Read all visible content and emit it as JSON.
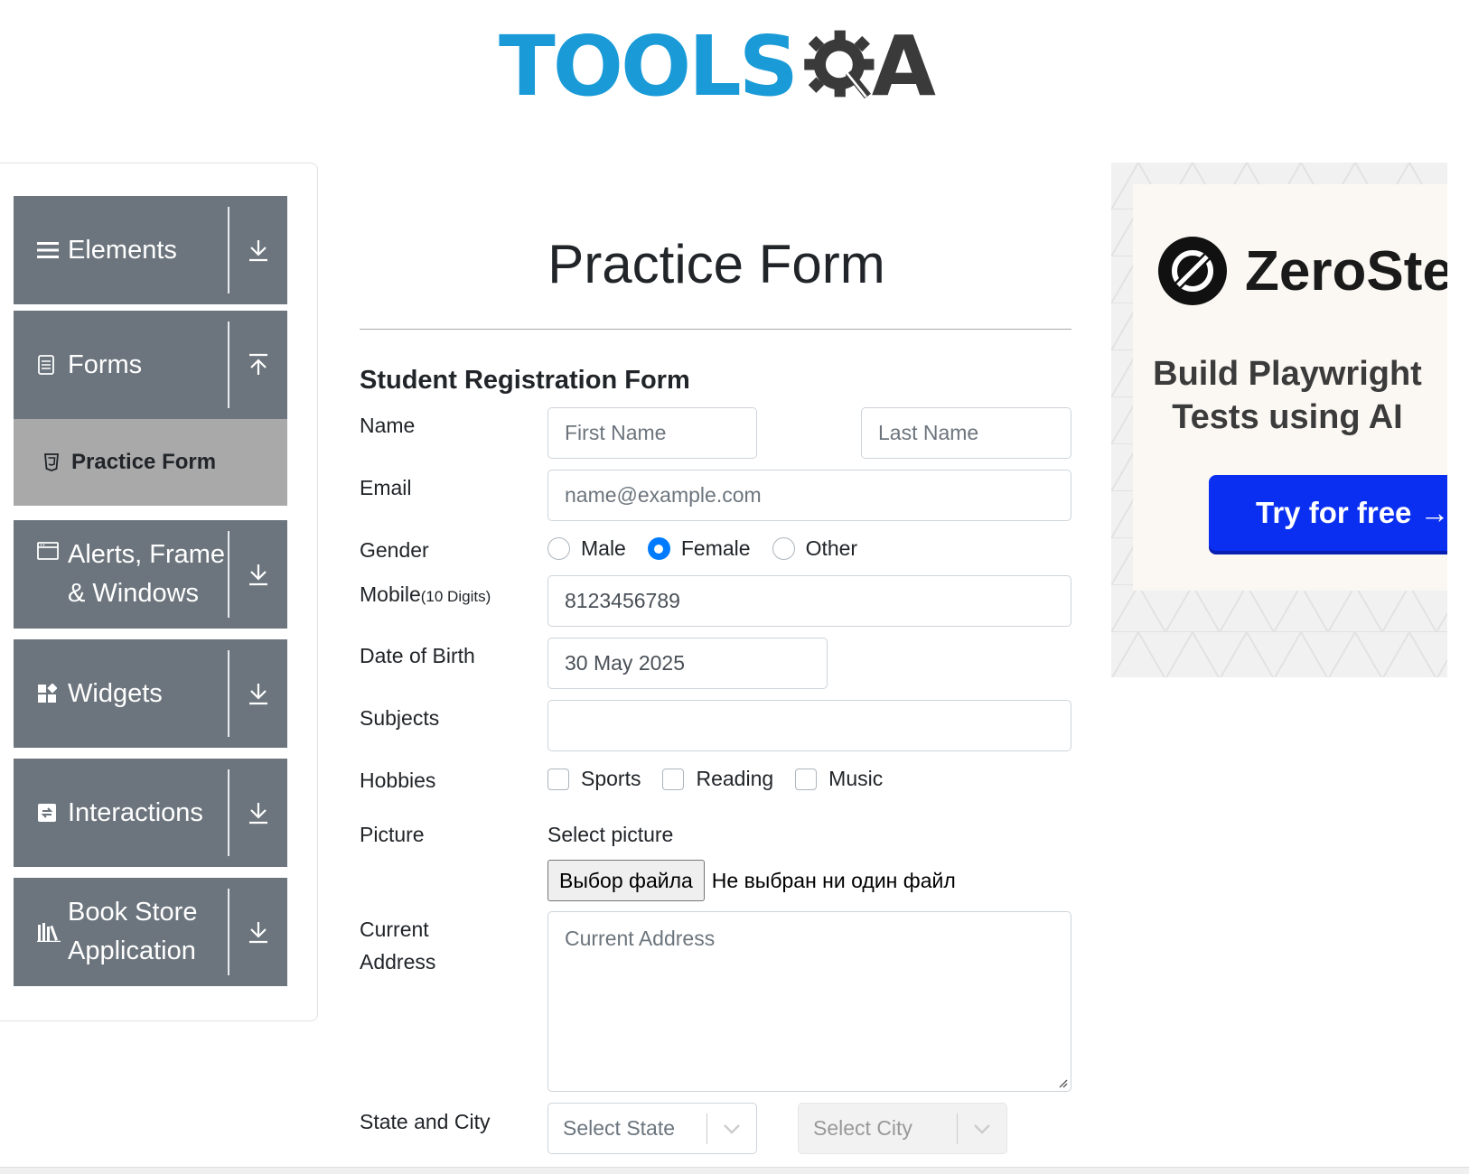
{
  "logo": {
    "text": "TOOLS",
    "suffix": "A",
    "icon": "gear-magnifier-icon",
    "colors": {
      "tools": "#1a9bd8",
      "qa": "#3a3a3a"
    }
  },
  "sidebar": {
    "groups": [
      {
        "label": "Elements",
        "icon": "hamburger-icon",
        "arrow": "download-arrow-icon"
      },
      {
        "label": "Forms",
        "icon": "document-icon",
        "arrow": "upload-arrow-icon",
        "expanded": true
      },
      {
        "label": "Alerts, Frame & Windows",
        "icon": "window-icon",
        "arrow": "download-arrow-icon"
      },
      {
        "label": "Widgets",
        "icon": "widgets-icon",
        "arrow": "download-arrow-icon"
      },
      {
        "label": "Interactions",
        "icon": "interactions-icon",
        "arrow": "download-arrow-icon"
      },
      {
        "label": "Book Store Application",
        "icon": "books-icon",
        "arrow": "download-arrow-icon"
      }
    ],
    "active_item": {
      "label": "Practice Form",
      "icon": "html5-icon"
    },
    "colors": {
      "group_bg": "#6c757d",
      "active_bg": "#a9a9a9"
    }
  },
  "form": {
    "page_title": "Practice Form",
    "heading": "Student Registration Form",
    "name": {
      "label": "Name",
      "first_placeholder": "First Name",
      "last_placeholder": "Last Name"
    },
    "email": {
      "label": "Email",
      "placeholder": "name@example.com"
    },
    "gender": {
      "label": "Gender",
      "options": [
        "Male",
        "Female",
        "Other"
      ],
      "selected": "Female"
    },
    "mobile": {
      "label": "Mobile",
      "hint": "(10 Digits)",
      "value": "8123456789"
    },
    "dob": {
      "label": "Date of Birth",
      "value": "30 May 2025"
    },
    "subjects": {
      "label": "Subjects",
      "value": ""
    },
    "hobbies": {
      "label": "Hobbies",
      "options": [
        "Sports",
        "Reading",
        "Music"
      ]
    },
    "picture": {
      "label": "Picture",
      "caption": "Select picture",
      "button": "Выбор файла",
      "status": "Не выбран ни один файл"
    },
    "address": {
      "label_line1": "Current",
      "label_line2": "Address",
      "placeholder": "Current Address"
    },
    "state_city": {
      "label": "State and City",
      "state_placeholder": "Select State",
      "city_placeholder": "Select City"
    },
    "colors": {
      "accent": "#007bff",
      "border": "#ced4da"
    }
  },
  "ad": {
    "brand": "ZeroStep",
    "copy_line1": "Build Playwright",
    "copy_line2": "Tests using AI",
    "button": "Try for free →",
    "colors": {
      "button": "#0a2ff0"
    }
  }
}
